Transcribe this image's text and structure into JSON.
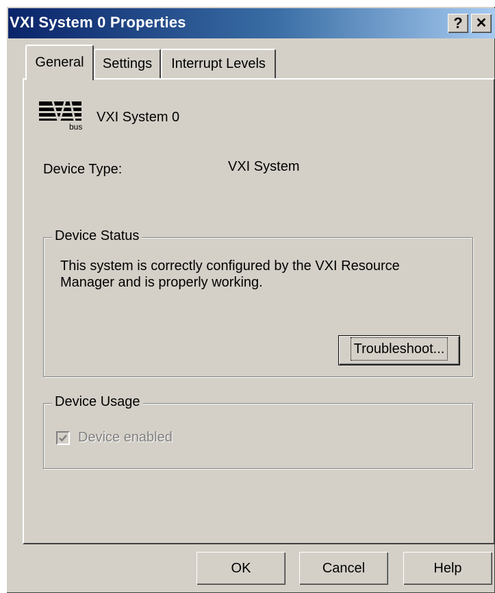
{
  "window": {
    "title": "VXI System 0 Properties",
    "help_button": "?",
    "close_button": "✕"
  },
  "tabs": [
    {
      "label": "General",
      "active": true
    },
    {
      "label": "Settings",
      "active": false
    },
    {
      "label": "Interrupt Levels",
      "active": false
    }
  ],
  "general": {
    "device_name": "VXI System 0",
    "device_type_label": "Device Type:",
    "device_type_value": "VXI System",
    "icon_sublabel": "bus",
    "status_group": {
      "legend": "Device Status",
      "text_line1": "This system is correctly configured by the VXI Resource",
      "text_line2": "Manager and is properly working.",
      "troubleshoot_label": "Troubleshoot..."
    },
    "usage_group": {
      "legend": "Device Usage",
      "checkbox_label": "Device enabled",
      "checked": true,
      "disabled": true
    }
  },
  "footer": {
    "ok_label": "OK",
    "cancel_label": "Cancel",
    "help_label": "Help"
  },
  "colors": {
    "face": "#d4d0c8",
    "title_start": "#0a246a",
    "title_end": "#a6caf0",
    "disabled_text": "#808080"
  }
}
